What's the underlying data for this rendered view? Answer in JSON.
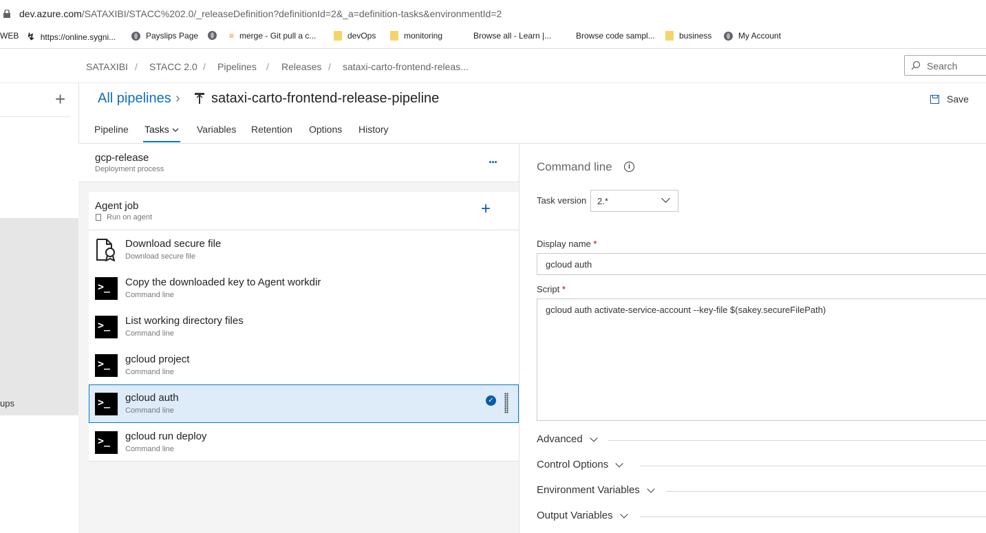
{
  "browser": {
    "url_host": "dev.azure.com",
    "url_path": "/SATAXIBI/STACC%202.0/_releaseDefinition?definitionId=2&_a=definition-tasks&environmentId=2",
    "bookmarks": [
      {
        "label": "WEB",
        "icon": "none"
      },
      {
        "label": "https://online.sygni...",
        "icon": "sygnia-icon"
      },
      {
        "label": "Payslips Page",
        "icon": "globe-icon"
      },
      {
        "label": "",
        "icon": "globe-icon"
      },
      {
        "label": "merge - Git pull a c...",
        "icon": "stackoverflow-icon"
      },
      {
        "label": "devOps",
        "icon": "folder-icon"
      },
      {
        "label": "monitoring",
        "icon": "folder-icon"
      },
      {
        "label": "Browse all - Learn |...",
        "icon": "microsoft-icon"
      },
      {
        "label": "Browse code sampl...",
        "icon": "microsoft-icon"
      },
      {
        "label": "business",
        "icon": "folder-icon"
      },
      {
        "label": "My Account",
        "icon": "globe-icon"
      }
    ]
  },
  "breadcrumb": [
    "SATAXIBI",
    "STACC 2.0",
    "Pipelines",
    "Releases",
    "sataxi-carto-frontend-releas..."
  ],
  "search": {
    "placeholder": "Search"
  },
  "rail": {
    "partial_label": "ups"
  },
  "header": {
    "all_pipelines": "All pipelines",
    "pipeline_name": "sataxi-carto-frontend-release-pipeline",
    "save_label": "Save"
  },
  "tabs": [
    "Pipeline",
    "Tasks",
    "Variables",
    "Retention",
    "Options",
    "History"
  ],
  "active_tab": "Tasks",
  "stage": {
    "name": "gcp-release",
    "subtitle": "Deployment process",
    "more": "..."
  },
  "agent_job": {
    "name": "Agent job",
    "subtitle": "Run on agent"
  },
  "tasks": [
    {
      "name": "Download secure file",
      "sub": "Download secure file",
      "icon": "secure-file-icon"
    },
    {
      "name": "Copy the downloaded key to Agent workdir",
      "sub": "Command line",
      "icon": "terminal-icon"
    },
    {
      "name": "List working directory files",
      "sub": "Command line",
      "icon": "terminal-icon"
    },
    {
      "name": "gcloud project",
      "sub": "Command line",
      "icon": "terminal-icon"
    },
    {
      "name": "gcloud auth",
      "sub": "Command line",
      "icon": "terminal-icon",
      "selected": true
    },
    {
      "name": "gcloud run deploy",
      "sub": "Command line",
      "icon": "terminal-icon"
    }
  ],
  "terminal_glyph": ">_",
  "detail": {
    "title": "Command line",
    "task_version_label": "Task version",
    "task_version": "2.*",
    "display_name_label": "Display name",
    "display_name": "gcloud auth",
    "script_label": "Script",
    "script": "gcloud auth activate-service-account --key-file $(sakey.secureFilePath)",
    "required_mark": "*",
    "sections": [
      "Advanced",
      "Control Options",
      "Environment Variables",
      "Output Variables"
    ]
  },
  "colors": {
    "accent": "#0078d4",
    "link": "#106ebe",
    "selected_bg": "#deecf9"
  }
}
